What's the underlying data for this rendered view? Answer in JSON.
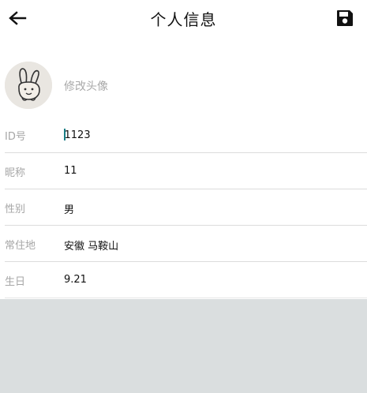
{
  "header": {
    "title": "个人信息",
    "back_icon": "arrow-left-icon",
    "save_icon": "floppy-save-icon"
  },
  "avatar": {
    "icon": "bunny-avatar-icon",
    "change_label": "修改头像"
  },
  "fields": [
    {
      "label": "ID号",
      "value": "1123",
      "focused": true
    },
    {
      "label": "昵称",
      "value": "11"
    },
    {
      "label": "性别",
      "value": "男"
    },
    {
      "label": "常住地",
      "value": "安徽 马鞍山"
    },
    {
      "label": "生日",
      "value": "9.21"
    }
  ],
  "colors": {
    "label": "#a6a6a6",
    "divider": "#dcdcdc",
    "bottom_bg": "#dadedf",
    "cursor": "#1a7f86"
  }
}
